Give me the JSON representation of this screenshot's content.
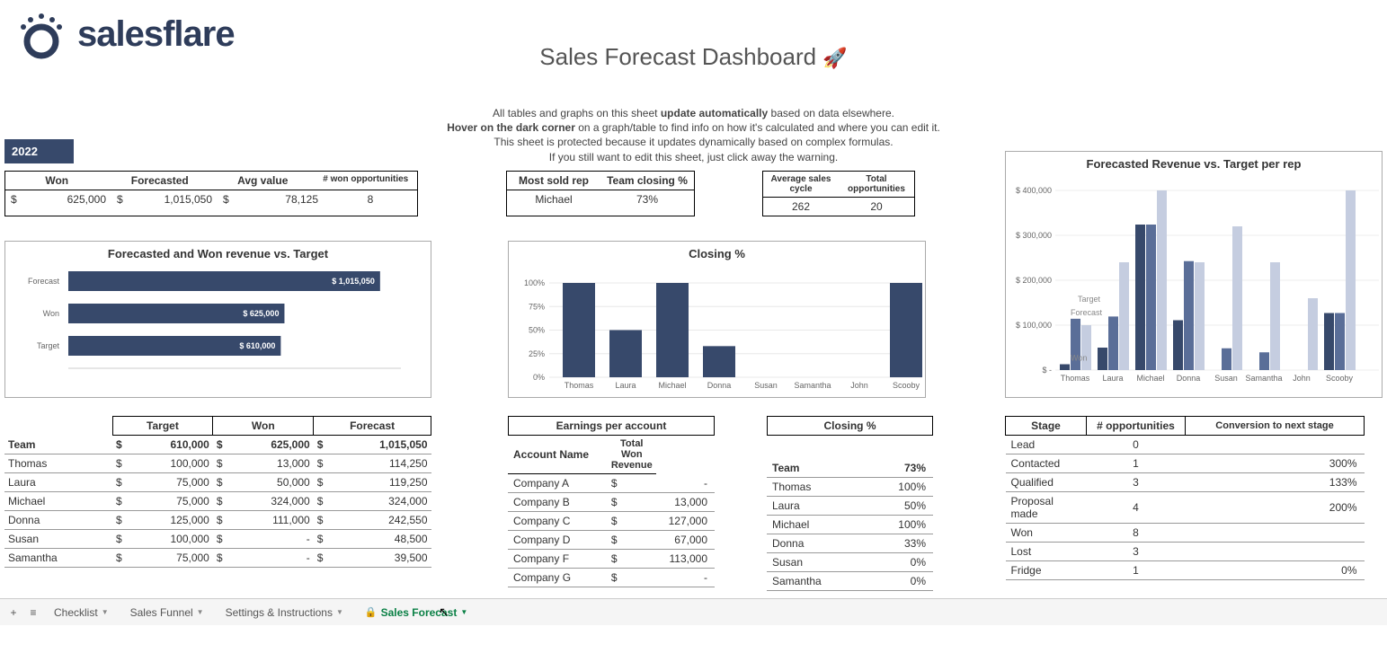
{
  "brand": "salesflare",
  "title": "Sales Forecast Dashboard",
  "intro": {
    "l1a": "All tables and graphs on this sheet ",
    "l1b": "update automatically",
    "l1c": " based on data elsewhere.",
    "l2a": "Hover on the dark corner",
    "l2b": " on a graph/table to find info on how it's calculated and where you can edit it.",
    "l3": "This sheet is protected because it updates dynamically based on complex formulas.",
    "l4": "If you still want to edit this sheet, just click away the warning."
  },
  "year": "2022",
  "summary": {
    "left": {
      "headers": [
        "Won",
        "Forecasted",
        "Avg value",
        "# won opportunities"
      ],
      "won": "625,000",
      "forecasted": "1,015,050",
      "avg": "78,125",
      "count": "8"
    },
    "mid": {
      "headers": [
        "Most sold rep",
        "Team closing %"
      ],
      "rep": "Michael",
      "pct": "73%"
    },
    "right": {
      "headers": [
        "Average sales cycle",
        "Total opportunities"
      ],
      "cycle": "262",
      "total": "20"
    }
  },
  "chart_data": [
    {
      "type": "bar",
      "orientation": "horizontal",
      "title": "Forecasted and Won revenue vs. Target",
      "categories": [
        "Forecast",
        "Won",
        "Target"
      ],
      "values": [
        1015050,
        625000,
        610000
      ],
      "labels": [
        "$ 1,015,050",
        "$ 625,000",
        "$ 610,000"
      ],
      "xlim": [
        0,
        1100000
      ]
    },
    {
      "type": "bar",
      "title": "Closing %",
      "categories": [
        "Thomas",
        "Laura",
        "Michael",
        "Donna",
        "Susan",
        "Samantha",
        "John",
        "Scooby"
      ],
      "values": [
        100,
        50,
        100,
        33,
        0,
        0,
        0,
        100
      ],
      "ylim": [
        0,
        100
      ],
      "yticks": [
        "0%",
        "25%",
        "50%",
        "75%",
        "100%"
      ]
    },
    {
      "type": "bar",
      "title": "Forecasted Revenue vs. Target per rep",
      "categories": [
        "Thomas",
        "Laura",
        "Michael",
        "Donna",
        "Susan",
        "Samantha",
        "John",
        "Scooby"
      ],
      "series": [
        {
          "name": "Won",
          "values": [
            13000,
            50000,
            324000,
            111000,
            0,
            0,
            0,
            127000
          ]
        },
        {
          "name": "Forecast",
          "values": [
            114250,
            119250,
            324000,
            242550,
            48500,
            39500,
            0,
            127000
          ]
        },
        {
          "name": "Target",
          "values": [
            100000,
            240000,
            400000,
            240000,
            320000,
            240000,
            160000,
            400000
          ]
        }
      ],
      "annotations": [
        "Won",
        "Forecast",
        "Target"
      ],
      "ylim": [
        0,
        400000
      ],
      "yticks": [
        "$ -",
        "$ 100,000",
        "$ 200,000",
        "$ 300,000",
        "$ 400,000"
      ]
    }
  ],
  "team_table": {
    "headers": [
      "Target",
      "Won",
      "Forecast"
    ],
    "rows": [
      {
        "name": "Team",
        "target": "610,000",
        "won": "625,000",
        "forecast": "1,015,050",
        "bold": true
      },
      {
        "name": "Thomas",
        "target": "100,000",
        "won": "13,000",
        "forecast": "114,250"
      },
      {
        "name": "Laura",
        "target": "75,000",
        "won": "50,000",
        "forecast": "119,250"
      },
      {
        "name": "Michael",
        "target": "75,000",
        "won": "324,000",
        "forecast": "324,000"
      },
      {
        "name": "Donna",
        "target": "125,000",
        "won": "111,000",
        "forecast": "242,550"
      },
      {
        "name": "Susan",
        "target": "100,000",
        "won": "-",
        "forecast": "48,500"
      },
      {
        "name": "Samantha",
        "target": "75,000",
        "won": "-",
        "forecast": "39,500"
      }
    ]
  },
  "earnings": {
    "title": "Earnings per account",
    "col1": "Account Name",
    "col2": "Total Won Revenue",
    "rows": [
      {
        "name": "Company A",
        "val": "-"
      },
      {
        "name": "Company B",
        "val": "13,000"
      },
      {
        "name": "Company C",
        "val": "127,000"
      },
      {
        "name": "Company D",
        "val": "67,000"
      },
      {
        "name": "Company F",
        "val": "113,000"
      },
      {
        "name": "Company G",
        "val": "-"
      }
    ]
  },
  "closing_table": {
    "title": "Closing %",
    "rows": [
      {
        "name": "Team",
        "val": "73%",
        "bold": true
      },
      {
        "name": "Thomas",
        "val": "100%"
      },
      {
        "name": "Laura",
        "val": "50%"
      },
      {
        "name": "Michael",
        "val": "100%"
      },
      {
        "name": "Donna",
        "val": "33%"
      },
      {
        "name": "Susan",
        "val": "0%"
      },
      {
        "name": "Samantha",
        "val": "0%"
      }
    ]
  },
  "stage_table": {
    "headers": [
      "Stage",
      "# opportunities",
      "Conversion to next stage"
    ],
    "rows": [
      {
        "stage": "Lead",
        "n": "0",
        "conv": ""
      },
      {
        "stage": "Contacted",
        "n": "1",
        "conv": "300%"
      },
      {
        "stage": "Qualified",
        "n": "3",
        "conv": "133%"
      },
      {
        "stage": "Proposal made",
        "n": "4",
        "conv": "200%"
      },
      {
        "stage": "Won",
        "n": "8",
        "conv": ""
      },
      {
        "stage": "Lost",
        "n": "3",
        "conv": ""
      },
      {
        "stage": "Fridge",
        "n": "1",
        "conv": "0%"
      }
    ]
  },
  "tabs": {
    "t1": "Checklist",
    "t2": "Sales Funnel",
    "t3": "Settings & Instructions",
    "t4": "Sales Forecast"
  }
}
